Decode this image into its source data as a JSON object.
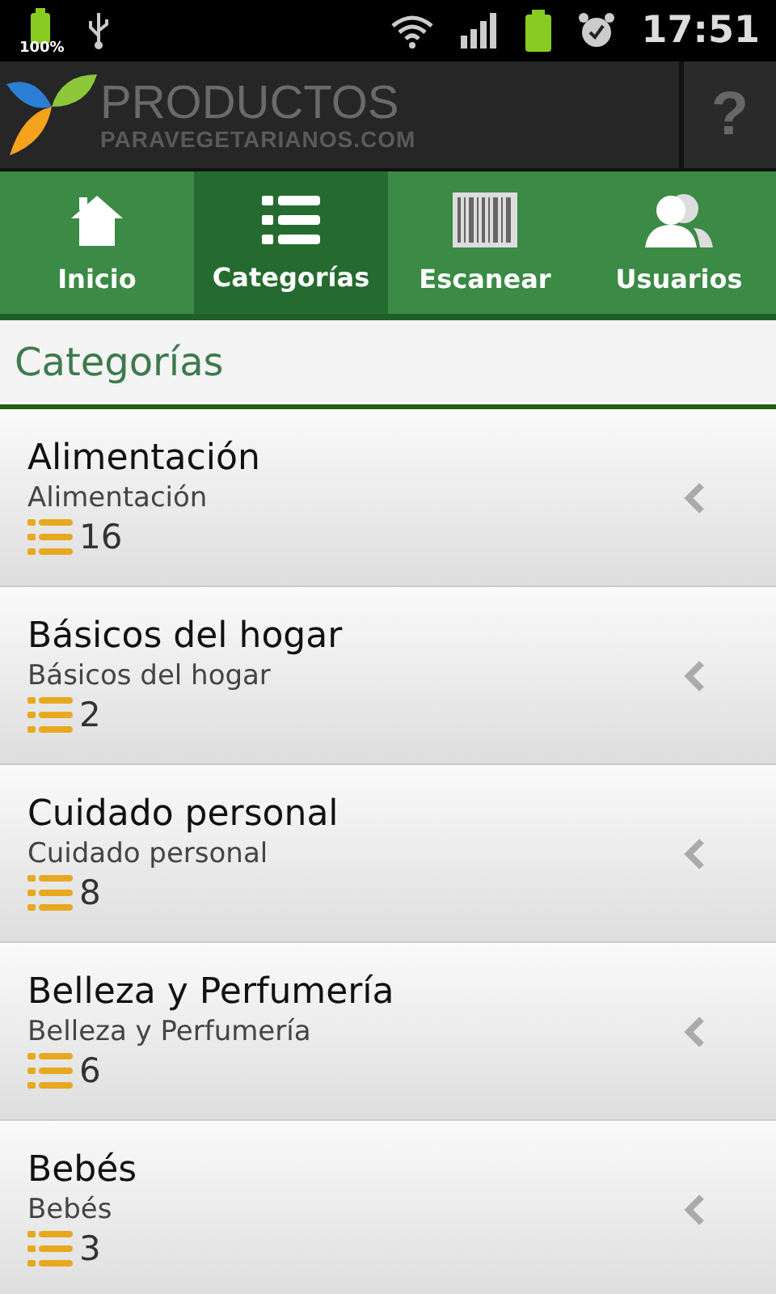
{
  "status_bar": {
    "battery_percent": "100%",
    "time": "17:51"
  },
  "header": {
    "logo_title": "PRODUCTOS",
    "logo_subtitle": "PARAVEGETARIANOS.COM",
    "help": "?"
  },
  "tabs": [
    {
      "label": "Inicio",
      "kind": "home",
      "selected": false
    },
    {
      "label": "Categorías",
      "kind": "list",
      "selected": true
    },
    {
      "label": "Escanear",
      "kind": "barcode",
      "selected": false
    },
    {
      "label": "Usuarios",
      "kind": "users",
      "selected": false
    }
  ],
  "section_title": "Categorías",
  "categories": [
    {
      "name": "Alimentación",
      "subtitle": "Alimentación",
      "count": "16"
    },
    {
      "name": "Básicos del hogar",
      "subtitle": "Básicos del hogar",
      "count": "2"
    },
    {
      "name": "Cuidado personal",
      "subtitle": "Cuidado personal",
      "count": "8"
    },
    {
      "name": "Belleza y Perfumería",
      "subtitle": "Belleza y Perfumería",
      "count": "6"
    },
    {
      "name": "Bebés",
      "subtitle": "Bebés",
      "count": "3"
    }
  ]
}
